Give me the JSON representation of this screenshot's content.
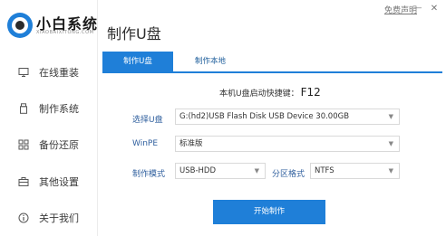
{
  "brand": {
    "name_cn": "小白系统",
    "name_en": "XIAOBAIXITONG.COM"
  },
  "window": {
    "help_label": "免费声明",
    "minimize": "—",
    "close": "✕"
  },
  "title": "制作U盘",
  "sidebar": {
    "items": [
      {
        "label": "在线重装",
        "icon": "monitor-icon",
        "active": false
      },
      {
        "label": "制作系统",
        "icon": "usb-drive-icon",
        "active": true
      },
      {
        "label": "备份还原",
        "icon": "backup-icon",
        "active": false
      },
      {
        "label": "其他设置",
        "icon": "briefcase-icon",
        "active": false
      },
      {
        "label": "关于我们",
        "icon": "info-icon",
        "active": false
      }
    ]
  },
  "tabs": [
    {
      "label": "制作U盘",
      "active": true
    },
    {
      "label": "制作本地",
      "active": false
    }
  ],
  "hotkey": {
    "label": "本机U盘启动快捷键：",
    "key": "F12"
  },
  "form": {
    "usb_label": "选择U盘",
    "usb_value": "G:(hd2)USB Flash Disk USB Device 30.00GB",
    "winpe_label": "WinPE",
    "winpe_value": "标准版",
    "mode_label": "制作模式",
    "mode_value": "USB-HDD",
    "partition_label": "分区格式",
    "partition_value": "NTFS"
  },
  "start_button": "开始制作",
  "colors": {
    "accent": "#1f7fd8",
    "label": "#2f5f9e"
  }
}
